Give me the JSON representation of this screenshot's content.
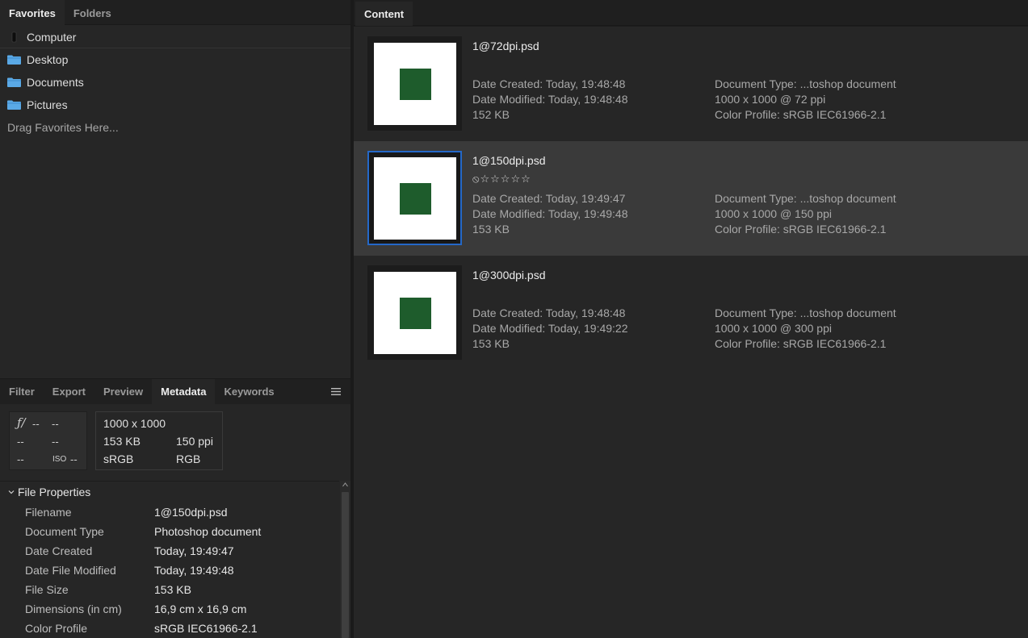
{
  "favorites_panel": {
    "tabs": [
      {
        "label": "Favorites",
        "active": true
      },
      {
        "label": "Folders",
        "active": false
      }
    ],
    "items": [
      {
        "label": "Computer",
        "icon": "computer-icon"
      },
      {
        "label": "Desktop",
        "icon": "folder-icon"
      },
      {
        "label": "Documents",
        "icon": "folder-icon"
      },
      {
        "label": "Pictures",
        "icon": "folder-icon"
      }
    ],
    "drag_hint": "Drag Favorites Here..."
  },
  "lower_panel": {
    "tabs": [
      {
        "label": "Filter",
        "active": false
      },
      {
        "label": "Export",
        "active": false
      },
      {
        "label": "Preview",
        "active": false
      },
      {
        "label": "Metadata",
        "active": true
      },
      {
        "label": "Keywords",
        "active": false
      }
    ],
    "camera": {
      "fstop_icon": "ƒ/",
      "fstop": "--",
      "shutter": "--",
      "r2c1": "--",
      "r2c2": "--",
      "r3c1": "--",
      "iso_label": "ISO",
      "iso": "--"
    },
    "info": {
      "dimensions": "1000 x 1000",
      "size": "153 KB",
      "resolution": "150 ppi",
      "profile": "sRGB",
      "mode": "RGB"
    },
    "file_properties": {
      "title": "File Properties",
      "rows": [
        {
          "key": "Filename",
          "value": "1@150dpi.psd"
        },
        {
          "key": "Document Type",
          "value": "Photoshop document"
        },
        {
          "key": "Date Created",
          "value": "Today, 19:49:47"
        },
        {
          "key": "Date File Modified",
          "value": "Today, 19:49:48"
        },
        {
          "key": "File Size",
          "value": "153 KB"
        },
        {
          "key": "Dimensions (in cm)",
          "value": "16,9 cm x 16,9 cm"
        },
        {
          "key": "Color Profile",
          "value": "sRGB IEC61966-2.1"
        }
      ]
    }
  },
  "content_panel": {
    "tab": "Content",
    "items": [
      {
        "filename": "1@72dpi.psd",
        "rating": "",
        "selected": false,
        "date_created": "Date Created: Today, 19:48:48",
        "date_modified": "Date Modified: Today, 19:48:48",
        "size": "152 KB",
        "doc_type": "Document Type: ...toshop document",
        "dims": "1000 x 1000 @ 72 ppi",
        "profile": "Color Profile: sRGB IEC61966-2.1"
      },
      {
        "filename": "1@150dpi.psd",
        "rating": "⦸☆☆☆☆☆",
        "selected": true,
        "date_created": "Date Created: Today, 19:49:47",
        "date_modified": "Date Modified: Today, 19:49:48",
        "size": "153 KB",
        "doc_type": "Document Type: ...toshop document",
        "dims": "1000 x 1000 @ 150 ppi",
        "profile": "Color Profile: sRGB IEC61966-2.1"
      },
      {
        "filename": "1@300dpi.psd",
        "rating": "",
        "selected": false,
        "date_created": "Date Created: Today, 19:48:48",
        "date_modified": "Date Modified: Today, 19:49:22",
        "size": "153 KB",
        "doc_type": "Document Type: ...toshop document",
        "dims": "1000 x 1000 @ 300 ppi",
        "profile": "Color Profile: sRGB IEC61966-2.1"
      }
    ]
  },
  "colors": {
    "selection_border": "#2468c8",
    "thumbnail_square": "#1e5c2c",
    "folder_icon": "#5aa9e6"
  }
}
